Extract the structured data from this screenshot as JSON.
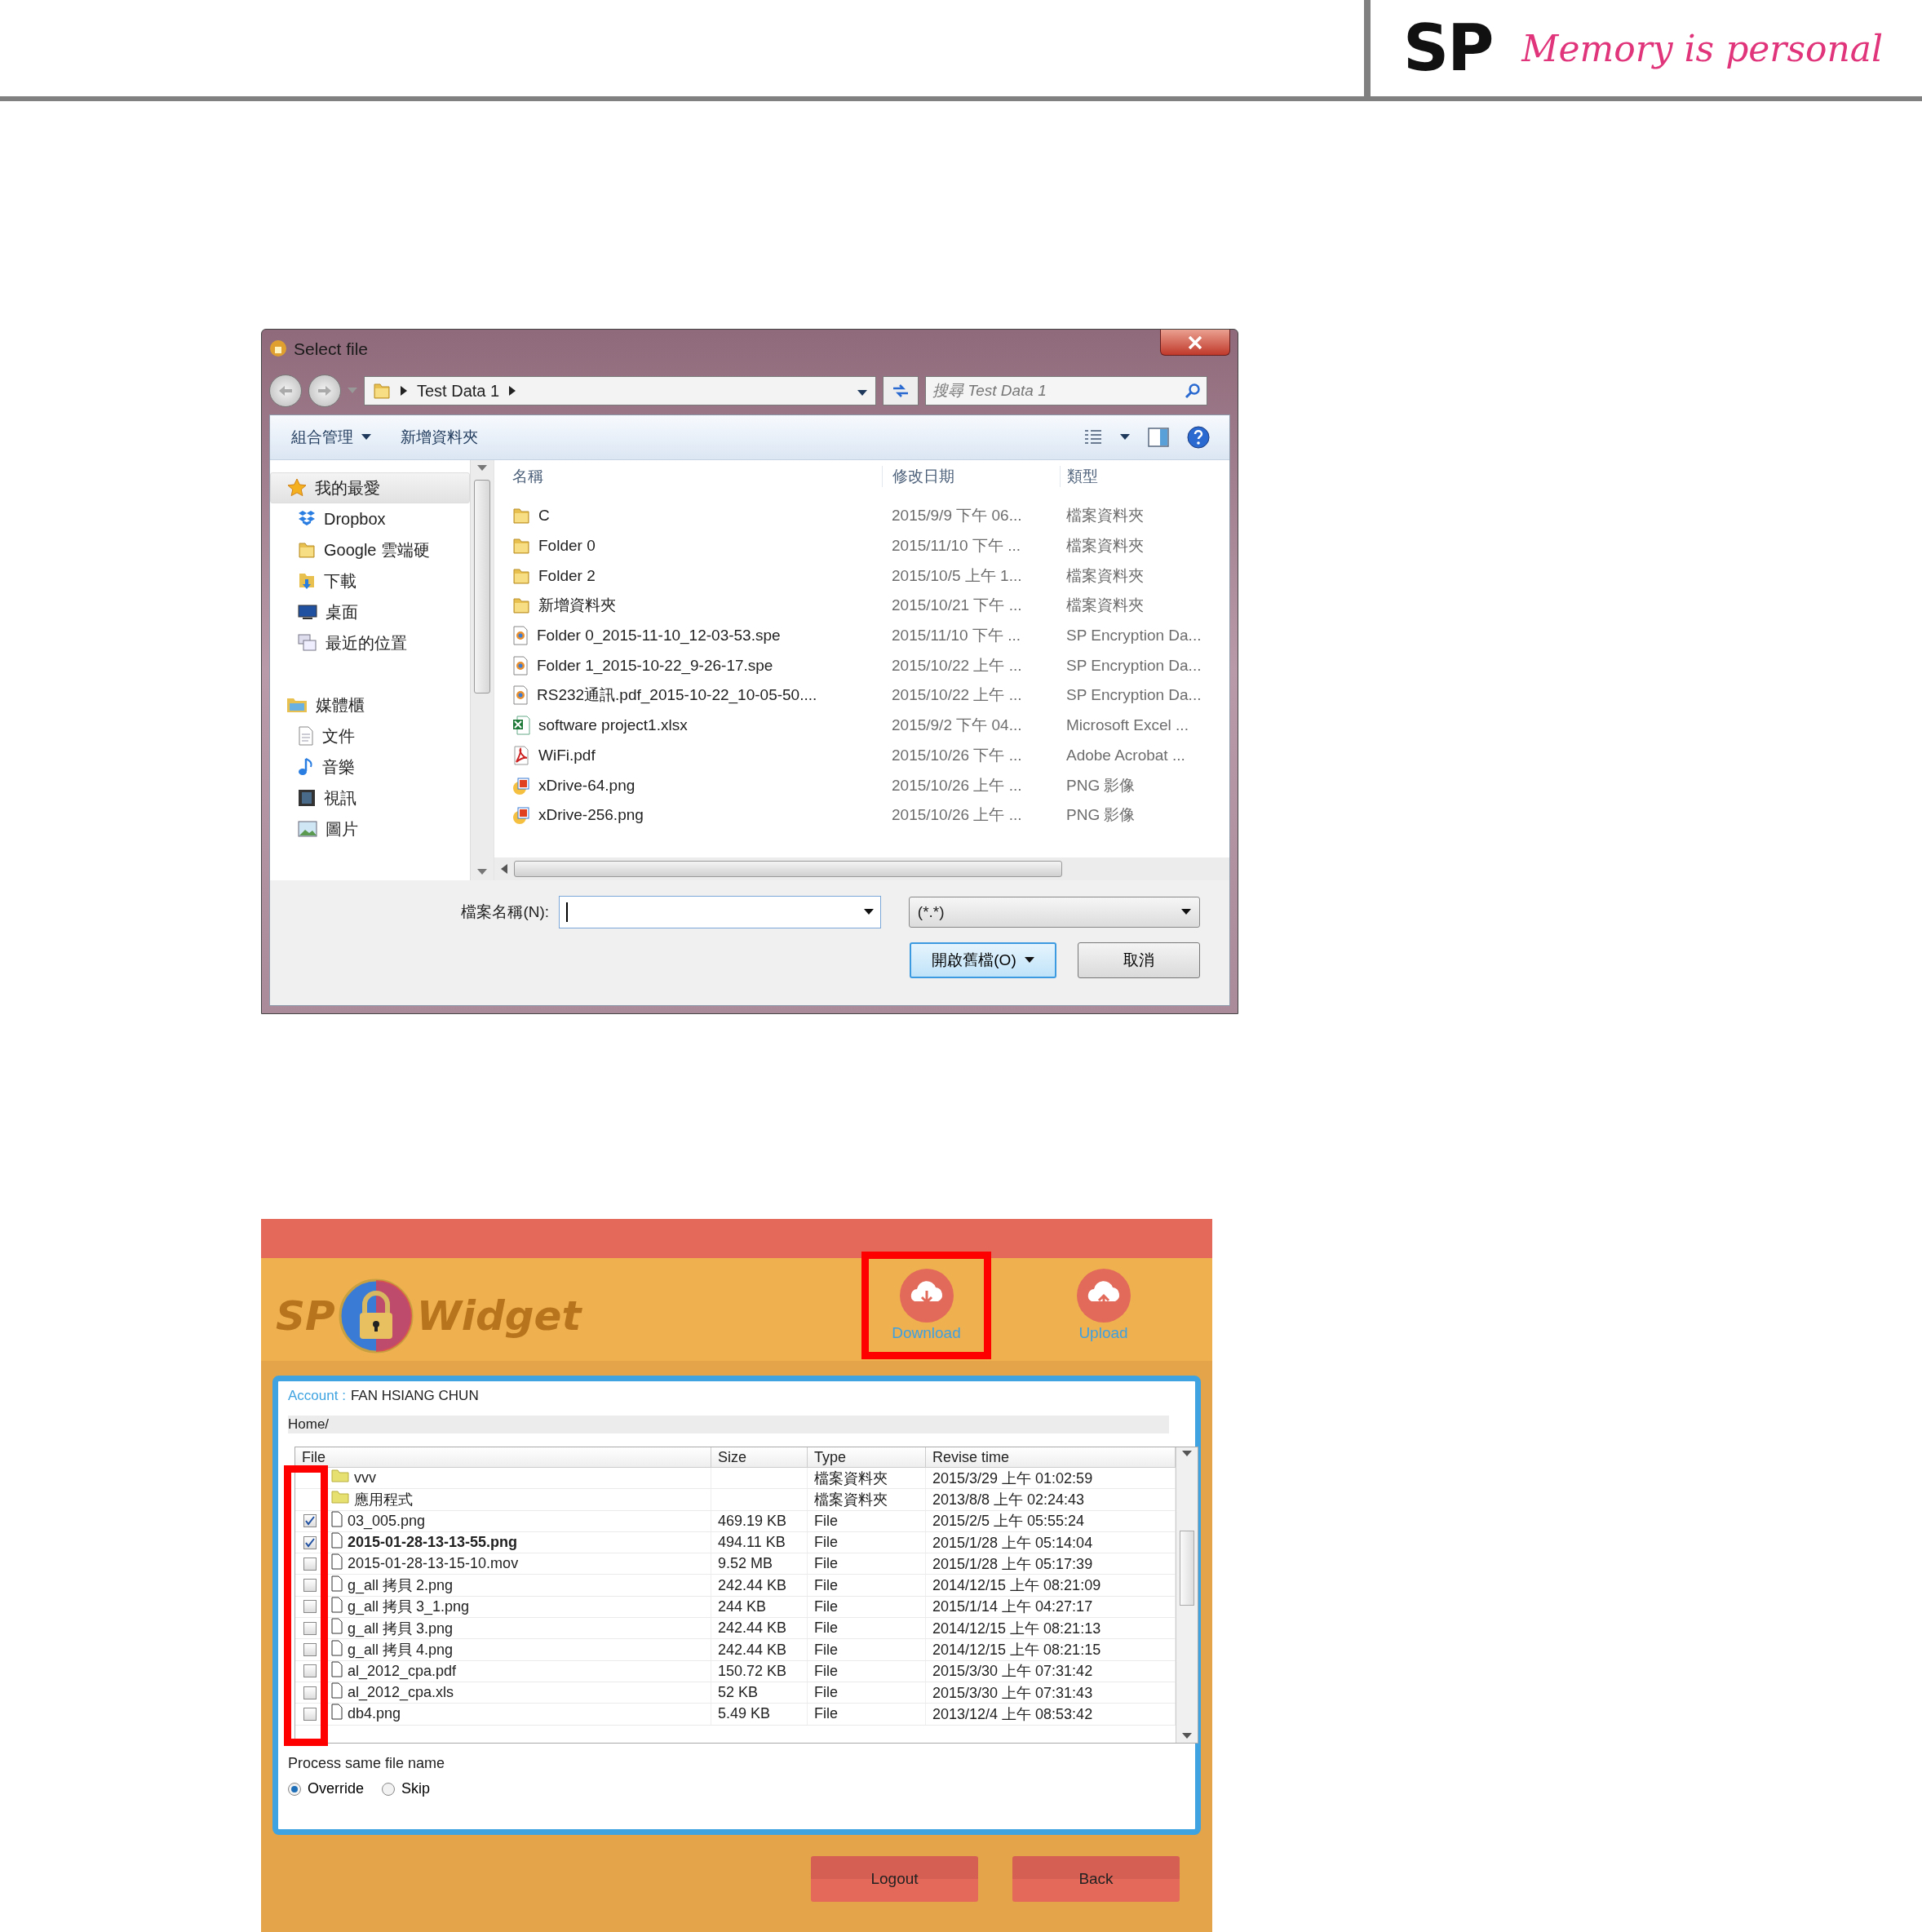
{
  "header": {
    "logo": "SP",
    "tagline": "Memory is personal"
  },
  "dialog": {
    "title": "Select file",
    "path": "Test Data 1",
    "search": {
      "placeholder": "搜尋 Test Data 1"
    },
    "toolbar": [
      {
        "label": "組合管理",
        "kind": "menu"
      },
      {
        "label": "新增資料夾",
        "kind": "button"
      }
    ],
    "nav": [
      {
        "label": "我的最愛",
        "kind": "favorites",
        "selected": true,
        "children": [
          {
            "label": "Dropbox",
            "kind": "dropbox",
            "selected": false
          },
          {
            "label": "Google 雲端硬",
            "kind": "drive",
            "selected": false
          },
          {
            "label": "下載",
            "kind": "downloads",
            "selected": false
          },
          {
            "label": "桌面",
            "kind": "desktop",
            "selected": false
          },
          {
            "label": "最近的位置",
            "kind": "recent",
            "selected": false
          }
        ]
      },
      {
        "label": "媒體櫃",
        "kind": "library",
        "selected": false,
        "children": [
          {
            "label": "文件",
            "kind": "documents",
            "selected": false
          },
          {
            "label": "音樂",
            "kind": "music",
            "selected": false
          },
          {
            "label": "視訊",
            "kind": "videos",
            "selected": false
          },
          {
            "label": "圖片",
            "kind": "pictures",
            "selected": false
          }
        ]
      }
    ],
    "columns": [
      "名稱",
      "修改日期",
      "類型"
    ],
    "files": [
      {
        "name": "C",
        "date": "2015/9/9 下午 06...",
        "type": "檔案資料夾",
        "kind": "folder"
      },
      {
        "name": "Folder 0",
        "date": "2015/11/10 下午 ...",
        "type": "檔案資料夾",
        "kind": "folder"
      },
      {
        "name": "Folder 2",
        "date": "2015/10/5 上午 1...",
        "type": "檔案資料夾",
        "kind": "folder"
      },
      {
        "name": "新增資料夾",
        "date": "2015/10/21 下午 ...",
        "type": "檔案資料夾",
        "kind": "folder"
      },
      {
        "name": "Folder 0_2015-11-10_12-03-53.spe",
        "date": "2015/11/10 下午 ...",
        "type": "SP Encryption Da...",
        "kind": "spe"
      },
      {
        "name": "Folder 1_2015-10-22_9-26-17.spe",
        "date": "2015/10/22 上午 ...",
        "type": "SP Encryption Da...",
        "kind": "spe"
      },
      {
        "name": "RS232通訊.pdf_2015-10-22_10-05-50....",
        "date": "2015/10/22 上午 ...",
        "type": "SP Encryption Da...",
        "kind": "spe"
      },
      {
        "name": "software project1.xlsx",
        "date": "2015/9/2 下午 04...",
        "type": "Microsoft Excel ...",
        "kind": "excel"
      },
      {
        "name": "WiFi.pdf",
        "date": "2015/10/26 下午 ...",
        "type": "Adobe Acrobat ...",
        "kind": "pdf"
      },
      {
        "name": "xDrive-64.png",
        "date": "2015/10/26 上午 ...",
        "type": "PNG 影像",
        "kind": "image"
      },
      {
        "name": "xDrive-256.png",
        "date": "2015/10/26 上午 ...",
        "type": "PNG 影像",
        "kind": "image"
      }
    ],
    "filename_label": "檔案名稱(N):",
    "filetype": "(*.*)",
    "buttons": [
      {
        "label": "開啟舊檔(O)",
        "kind": "primary"
      },
      {
        "label": "取消",
        "kind": "secondary"
      }
    ]
  },
  "widget": {
    "brand": [
      "SP",
      "Widget"
    ],
    "actions": [
      {
        "label": "Download",
        "kind": "download",
        "highlighted": true
      },
      {
        "label": "Upload",
        "kind": "upload",
        "highlighted": false
      }
    ],
    "account": {
      "label": "Account :",
      "value": "FAN HSIANG CHUN"
    },
    "path": "Home/",
    "columns": [
      "File",
      "Size",
      "Type",
      "Revise time"
    ],
    "checkbox_column_highlighted": true,
    "rows": [
      {
        "kind": "folder",
        "name": "vvv",
        "type": "檔案資料夾",
        "time": "2015/3/29 上午 01:02:59",
        "selected": false
      },
      {
        "kind": "folder",
        "name": "應用程式",
        "type": "檔案資料夾",
        "time": "2013/8/8 上午 02:24:43",
        "selected": false
      },
      {
        "kind": "file",
        "name": "03_005.png",
        "size": "469.19 KB",
        "type": "File",
        "time": "2015/2/5 上午 05:55:24",
        "checked": true,
        "selected": false
      },
      {
        "kind": "file",
        "name": "2015-01-28-13-13-55.png",
        "size": "494.11 KB",
        "type": "File",
        "time": "2015/1/28 上午 05:14:04",
        "checked": true,
        "selected": true
      },
      {
        "kind": "file",
        "name": "2015-01-28-13-15-10.mov",
        "size": "9.52 MB",
        "type": "File",
        "time": "2015/1/28 上午 05:17:39",
        "checked": false,
        "selected": false
      },
      {
        "kind": "file",
        "name": "g_all 拷貝 2.png",
        "size": "242.44 KB",
        "type": "File",
        "time": "2014/12/15 上午 08:21:09",
        "checked": false,
        "selected": false
      },
      {
        "kind": "file",
        "name": "g_all 拷貝 3_1.png",
        "size": "244 KB",
        "type": "File",
        "time": "2015/1/14 上午 04:27:17",
        "checked": false,
        "selected": false
      },
      {
        "kind": "file",
        "name": "g_all 拷貝 3.png",
        "size": "242.44 KB",
        "type": "File",
        "time": "2014/12/15 上午 08:21:13",
        "checked": false,
        "selected": false
      },
      {
        "kind": "file",
        "name": "g_all 拷貝 4.png",
        "size": "242.44 KB",
        "type": "File",
        "time": "2014/12/15 上午 08:21:15",
        "checked": false,
        "selected": false
      },
      {
        "kind": "file",
        "name": "al_2012_cpa.pdf",
        "size": "150.72 KB",
        "type": "File",
        "time": "2015/3/30 上午 07:31:42",
        "checked": false,
        "selected": false
      },
      {
        "kind": "file",
        "name": "al_2012_cpa.xls",
        "size": "52 KB",
        "type": "File",
        "time": "2015/3/30 上午 07:31:43",
        "checked": false,
        "selected": false
      },
      {
        "kind": "file",
        "name": "db4.png",
        "size": "5.49 KB",
        "type": "File",
        "time": "2013/12/4 上午 08:53:42",
        "checked": false,
        "selected": false
      }
    ],
    "option_label": "Process same file name",
    "options": [
      {
        "label": "Override",
        "selected": true
      },
      {
        "label": "Skip",
        "selected": false
      }
    ],
    "buttons": [
      "Logout",
      "Back"
    ]
  }
}
